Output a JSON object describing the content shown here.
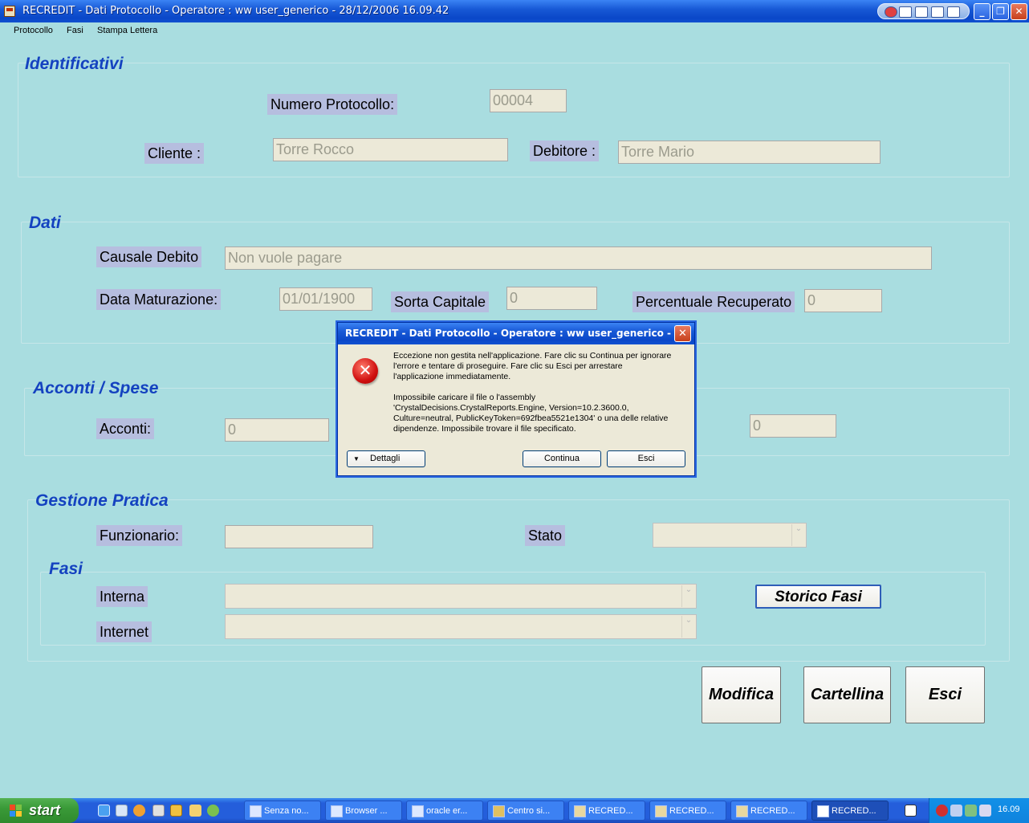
{
  "window": {
    "title": "RECREDIT  -  Dati Protocollo  - Operatore : ww user_generico - 28/12/2006 16.09.42"
  },
  "menu": [
    "Protocollo",
    "Fasi",
    "Stampa Lettera"
  ],
  "identificativi": {
    "title": "Identificativi",
    "numero_label": "Numero Protocollo:",
    "numero_value": "00004",
    "cliente_label": "Cliente :",
    "cliente_value": "Torre Rocco",
    "debitore_label": "Debitore :",
    "debitore_value": "Torre Mario"
  },
  "dati": {
    "title": "Dati",
    "causale_label": "Causale Debito",
    "causale_value": "Non vuole pagare",
    "data_label": "Data Maturazione:",
    "data_value": "01/01/1900",
    "sorta_label": "Sorta  Capitale",
    "sorta_value": "0",
    "perc_label": "Percentuale Recuperato",
    "perc_value": "0"
  },
  "acconti": {
    "title": "Acconti / Spese",
    "acconti_label": "Acconti:",
    "acconti_value": "0",
    "other_value": "0"
  },
  "gestione": {
    "title": "Gestione Pratica",
    "funz_label": "Funzionario:",
    "funz_value": "",
    "stato_label": "Stato",
    "stato_value": ""
  },
  "fasi": {
    "title": "Fasi",
    "interna_label": "Interna",
    "internet_label": "Internet",
    "storico_button": "Storico Fasi"
  },
  "buttons": {
    "modifica": "Modifica",
    "cartellina": "Cartellina",
    "esci": "Esci"
  },
  "dialog": {
    "title": "RECREDIT  -  Dati Protocollo  - Operatore : ww user_generico - ...",
    "message_lines": [
      "Eccezione non gestita nell'applicazione. Fare clic su Continua per ignorare",
      "l'errore e tentare di proseguire. Fare clic su Esci per arrestare",
      "l'applicazione immediatamente."
    ],
    "detail_lines": [
      "Impossibile caricare il file o l'assembly",
      "'CrystalDecisions.CrystalReports.Engine, Version=10.2.3600.0,",
      "Culture=neutral, PublicKeyToken=692fbea5521e1304' o una delle relative",
      "dipendenze. Impossibile trovare il file specificato."
    ],
    "details_button": "Dettagli",
    "continue_button": "Continua",
    "exit_button": "Esci"
  },
  "taskbar": {
    "start": "start",
    "tasks": [
      "Senza no...",
      "Browser ...",
      "oracle er...",
      "Centro si...",
      "RECRED...",
      "RECRED...",
      "RECRED...",
      "RECRED..."
    ],
    "clock": "16.09"
  }
}
